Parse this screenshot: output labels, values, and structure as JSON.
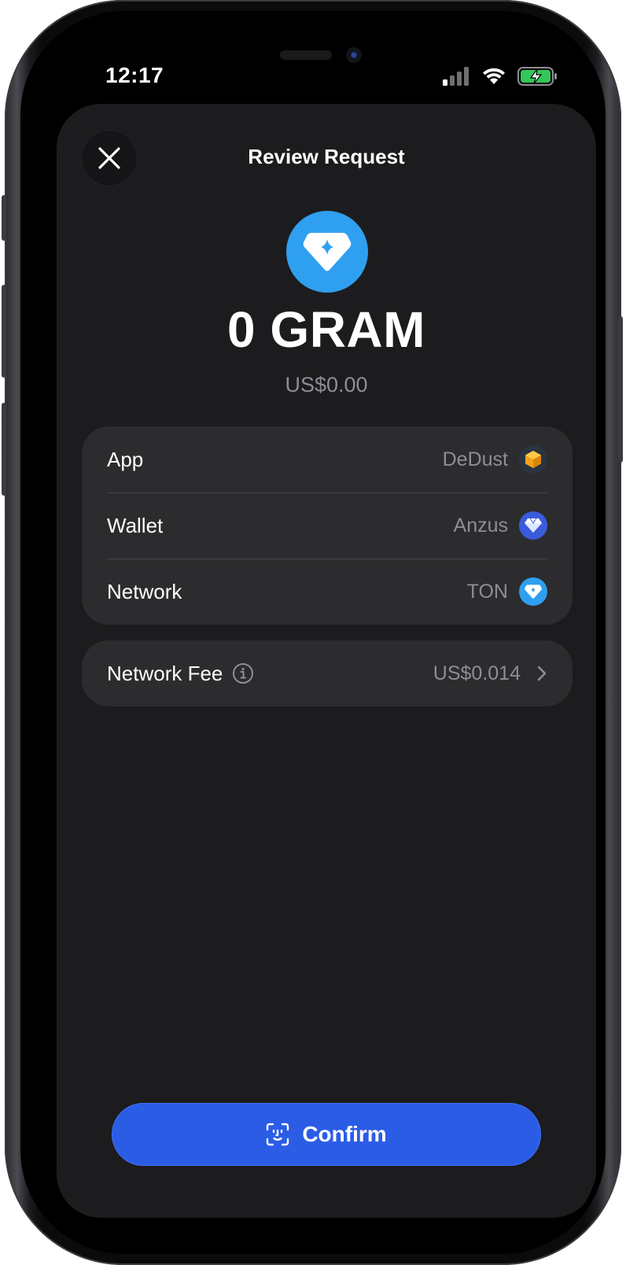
{
  "status_bar": {
    "time": "12:17",
    "icons": [
      "cellular-signal-icon",
      "wifi-icon",
      "battery-charging-icon"
    ]
  },
  "sheet": {
    "title": "Review Request",
    "close_icon": "close-icon"
  },
  "token": {
    "icon": "ton-diamond-icon",
    "amount": "0 GRAM",
    "fiat_value": "US$0.00",
    "accent_color": "#2f9ff0"
  },
  "details": {
    "rows": [
      {
        "label": "App",
        "value": "DeDust",
        "icon": "dedust-cube-icon"
      },
      {
        "label": "Wallet",
        "value": "Anzus",
        "icon": "wallet-diamond-icon"
      },
      {
        "label": "Network",
        "value": "TON",
        "icon": "ton-network-icon"
      }
    ]
  },
  "fee": {
    "label": "Network Fee",
    "info_icon": "info-icon",
    "value": "US$0.014",
    "chevron_icon": "chevron-right-icon"
  },
  "confirm_button": {
    "label": "Confirm",
    "icon": "face-id-icon",
    "color": "#2b5ce6"
  }
}
